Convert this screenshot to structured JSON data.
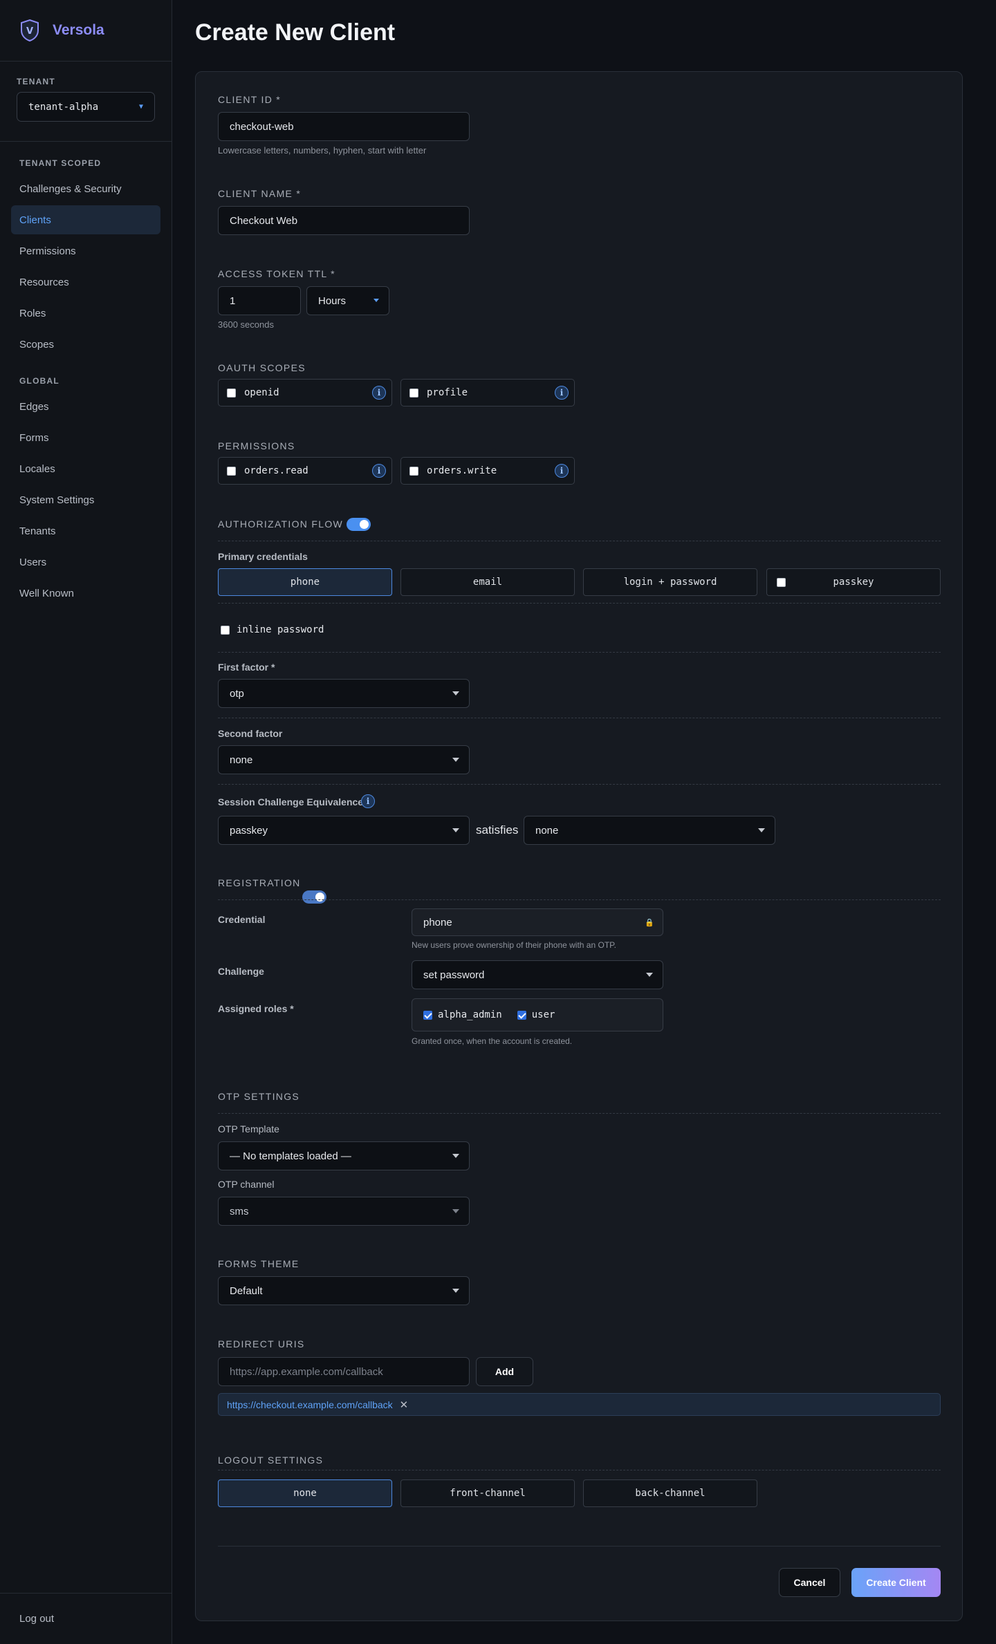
{
  "brand": {
    "name": "Versola",
    "logo_letter": "V"
  },
  "sidebar": {
    "tenant_label": "TENANT",
    "tenant_value": "tenant-alpha",
    "tenant_scoped_heading": "TENANT SCOPED",
    "tenant_scoped_items": [
      {
        "label": "Challenges & Security"
      },
      {
        "label": "Clients",
        "active": true
      },
      {
        "label": "Permissions"
      },
      {
        "label": "Resources"
      },
      {
        "label": "Roles"
      },
      {
        "label": "Scopes"
      }
    ],
    "global_heading": "GLOBAL",
    "global_items": [
      {
        "label": "Edges"
      },
      {
        "label": "Forms"
      },
      {
        "label": "Locales"
      },
      {
        "label": "System Settings"
      },
      {
        "label": "Tenants"
      },
      {
        "label": "Users"
      },
      {
        "label": "Well Known"
      }
    ],
    "logout_label": "Log out"
  },
  "page": {
    "title": "Create New Client"
  },
  "form": {
    "client_id": {
      "label": "CLIENT ID *",
      "value": "checkout-web",
      "hint": "Lowercase letters, numbers, hyphen, start with letter"
    },
    "client_name": {
      "label": "CLIENT NAME *",
      "value": "Checkout Web"
    },
    "access_ttl": {
      "label": "ACCESS TOKEN TTL *",
      "value": "1",
      "unit": "Hours",
      "hint": "3600 seconds"
    },
    "oauth_scopes": {
      "label": "OAUTH SCOPES",
      "items": [
        {
          "name": "openid"
        },
        {
          "name": "profile"
        }
      ]
    },
    "permissions": {
      "label": "PERMISSIONS",
      "items": [
        {
          "name": "orders.read"
        },
        {
          "name": "orders.write"
        }
      ]
    },
    "auth_flow": {
      "label": "AUTHORIZATION FLOW",
      "enabled": true,
      "primary_label": "Primary credentials",
      "primary_options": [
        "phone",
        "email",
        "login + password",
        "passkey"
      ],
      "primary_selected": "phone",
      "inline_password_label": "inline password",
      "first_factor_label": "First factor *",
      "first_factor_value": "otp",
      "second_factor_label": "Second factor",
      "second_factor_value": "none",
      "equiv_label": "Session Challenge Equivalences",
      "equiv_left": "passkey",
      "equiv_mid": "satisfies",
      "equiv_right": "none"
    },
    "registration": {
      "label": "REGISTRATION",
      "enabled": true,
      "credential_label": "Credential",
      "credential_value": "phone",
      "credential_hint": "New users prove ownership of their phone with an OTP.",
      "challenge_label": "Challenge",
      "challenge_value": "set password",
      "roles_label": "Assigned roles *",
      "roles": [
        {
          "name": "alpha_admin",
          "checked": true
        },
        {
          "name": "user",
          "checked": true
        }
      ],
      "roles_hint": "Granted once, when the account is created."
    },
    "otp": {
      "label": "OTP SETTINGS",
      "template_label": "OTP Template",
      "template_value": "— No templates loaded —",
      "channel_label": "OTP channel",
      "channel_value": "sms"
    },
    "forms_theme": {
      "label": "FORMS THEME",
      "value": "Default"
    },
    "redirect_uris": {
      "label": "REDIRECT URIS",
      "placeholder": "https://app.example.com/callback",
      "add_label": "Add",
      "items": [
        "https://checkout.example.com/callback"
      ]
    },
    "logout": {
      "label": "LOGOUT SETTINGS",
      "options": [
        "none",
        "front-channel",
        "back-channel"
      ],
      "selected": "none"
    },
    "actions": {
      "cancel_label": "Cancel",
      "create_label": "Create Client"
    }
  },
  "colors": {
    "accent": "#5fa2f7",
    "brand": "#8c8cf5",
    "background": "#0e1117",
    "card": "#161a21"
  }
}
